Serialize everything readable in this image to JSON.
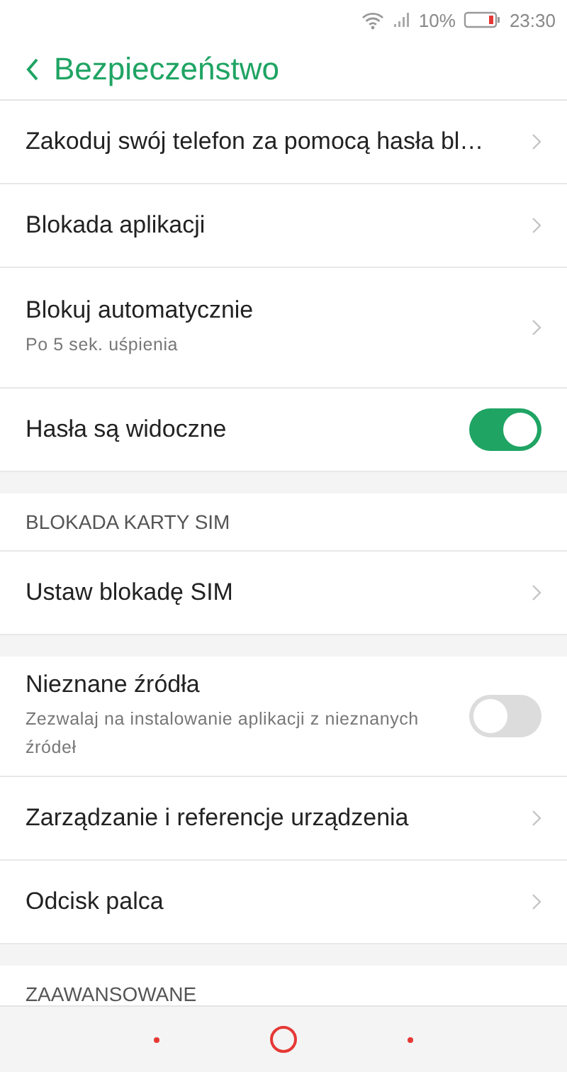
{
  "status_bar": {
    "battery_percent": "10%",
    "time": "23:30"
  },
  "header": {
    "title": "Bezpieczeństwo"
  },
  "sections": [
    {
      "items": [
        {
          "kind": "link",
          "title": "Zakoduj swój telefon za pomocą hasła bl…"
        },
        {
          "kind": "link",
          "title": "Blokada aplikacji"
        },
        {
          "kind": "link",
          "title": "Blokuj automatycznie",
          "subtitle": "Po 5 sek. uśpienia"
        },
        {
          "kind": "toggle",
          "title": "Hasła są widoczne",
          "on": true
        }
      ]
    },
    {
      "header": "BLOKADA KARTY SIM",
      "items": [
        {
          "kind": "link",
          "title": "Ustaw blokadę SIM"
        }
      ]
    },
    {
      "items": [
        {
          "kind": "toggle",
          "title": "Nieznane źródła",
          "subtitle": "Zezwalaj na instalowanie aplikacji z nieznanych źródeł",
          "on": false
        },
        {
          "kind": "link",
          "title": "Zarządzanie i referencje urządzenia"
        },
        {
          "kind": "link",
          "title": "Odcisk palca"
        }
      ]
    },
    {
      "header": "ZAAWANSOWANE"
    }
  ]
}
